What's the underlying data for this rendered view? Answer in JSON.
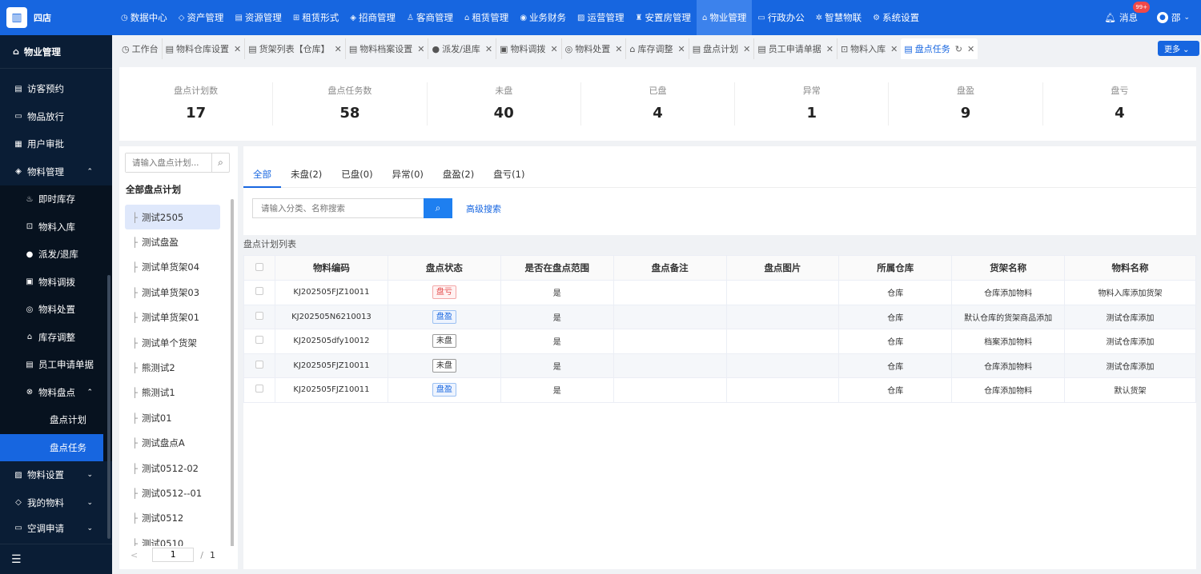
{
  "brand": {
    "logo": "四店",
    "name": "四店"
  },
  "topnav": {
    "items": [
      {
        "icon": "◷",
        "label": "数据中心"
      },
      {
        "icon": "◇",
        "label": "资产管理"
      },
      {
        "icon": "▤",
        "label": "资源管理"
      },
      {
        "icon": "⊞",
        "label": "租赁形式"
      },
      {
        "icon": "◈",
        "label": "招商管理"
      },
      {
        "icon": "♙",
        "label": "客商管理"
      },
      {
        "icon": "⌂",
        "label": "租赁管理"
      },
      {
        "icon": "◉",
        "label": "业务财务"
      },
      {
        "icon": "▨",
        "label": "运营管理"
      },
      {
        "icon": "♜",
        "label": "安置房管理"
      },
      {
        "icon": "⌂",
        "label": "物业管理"
      },
      {
        "icon": "▭",
        "label": "行政办公"
      },
      {
        "icon": "✲",
        "label": "智慧物联"
      },
      {
        "icon": "⚙",
        "label": "系统设置"
      }
    ],
    "active_index": 10,
    "messages_label": "消息",
    "messages_badge": "99+",
    "user_name": "邵"
  },
  "sidebar": {
    "header": "物业管理",
    "items": [
      {
        "icon": "▤",
        "label": "访客预约"
      },
      {
        "icon": "▭",
        "label": "物品放行"
      },
      {
        "icon": "▦",
        "label": "用户审批"
      },
      {
        "icon": "◈",
        "label": "物料管理",
        "chevron": "⌃"
      }
    ],
    "sub_items": [
      {
        "icon": "♨",
        "label": "即时库存"
      },
      {
        "icon": "⊡",
        "label": "物料入库"
      },
      {
        "icon": "●",
        "label": "派发/退库"
      },
      {
        "icon": "▣",
        "label": "物料调拨"
      },
      {
        "icon": "◎",
        "label": "物料处置"
      },
      {
        "icon": "⌂",
        "label": "库存调整"
      },
      {
        "icon": "▤",
        "label": "员工申请单据"
      },
      {
        "icon": "⊗",
        "label": "物料盘点",
        "chevron": "⌃"
      }
    ],
    "third_items": [
      {
        "label": "盘点计划"
      },
      {
        "label": "盘点任务"
      }
    ],
    "after_items": [
      {
        "icon": "▨",
        "label": "物料设置",
        "chevron": "⌄"
      },
      {
        "icon": "◇",
        "label": "我的物料",
        "chevron": "⌄"
      }
    ],
    "bottom_item": {
      "icon": "▭",
      "label": "空调申请",
      "chevron": "⌄"
    },
    "collapse_icon": "☰"
  },
  "tabs": [
    {
      "icon": "◷",
      "label": "工作台",
      "closable": false
    },
    {
      "icon": "▤",
      "label": "物料仓库设置",
      "closable": true
    },
    {
      "icon": "▤",
      "label": "货架列表【仓库】",
      "closable": true
    },
    {
      "icon": "▤",
      "label": "物料档案设置",
      "closable": true
    },
    {
      "icon": "●",
      "label": "派发/退库",
      "closable": true
    },
    {
      "icon": "▣",
      "label": "物料调拨",
      "closable": true
    },
    {
      "icon": "◎",
      "label": "物料处置",
      "closable": true
    },
    {
      "icon": "⌂",
      "label": "库存调整",
      "closable": true
    },
    {
      "icon": "▤",
      "label": "盘点计划",
      "closable": true
    },
    {
      "icon": "▤",
      "label": "员工申请单据",
      "closable": true
    },
    {
      "icon": "⊡",
      "label": "物料入库",
      "closable": true
    },
    {
      "icon": "▤",
      "label": "盘点任务",
      "closable": true,
      "active": true
    }
  ],
  "more_button": "更多 ⌄",
  "stats": [
    {
      "label": "盘点计划数",
      "value": "17"
    },
    {
      "label": "盘点任务数",
      "value": "58"
    },
    {
      "label": "未盘",
      "value": "40"
    },
    {
      "label": "已盘",
      "value": "4"
    },
    {
      "label": "异常",
      "value": "1"
    },
    {
      "label": "盘盈",
      "value": "9"
    },
    {
      "label": "盘亏",
      "value": "4"
    }
  ],
  "plan_panel": {
    "search_placeholder": "请输入盘点计划...",
    "title": "全部盘点计划",
    "plans": [
      "测试2505",
      "测试盘盈",
      "测试单货架04",
      "测试单货架03",
      "测试单货架01",
      "测试单个货架",
      "熊测试2",
      "熊测试1",
      "测试01",
      "测试盘点A",
      "测试0512-02",
      "测试0512--01",
      "测试0512",
      "测试0510"
    ],
    "active_index": 0,
    "pager": {
      "prev": "<",
      "current": "1",
      "separator": "/",
      "total": "1"
    }
  },
  "status_tabs": [
    {
      "label": "全部",
      "active": true
    },
    {
      "label": "未盘(2)"
    },
    {
      "label": "已盘(0)"
    },
    {
      "label": "异常(0)"
    },
    {
      "label": "盘盈(2)"
    },
    {
      "label": "盘亏(1)"
    }
  ],
  "search": {
    "placeholder": "请输入分类、名称搜索",
    "advanced": "高级搜索"
  },
  "list_title": "盘点计划列表",
  "table": {
    "columns": [
      "物料编码",
      "盘点状态",
      "是否在盘点范围",
      "盘点备注",
      "盘点图片",
      "所属仓库",
      "货架名称",
      "物料名称"
    ],
    "rows": [
      {
        "code": "KJ202505FJZ10011",
        "status": "盘亏",
        "status_type": "loss",
        "in_range": "是",
        "remark": "",
        "image": "",
        "warehouse": "仓库",
        "shelf": "仓库添加物料",
        "material": "物料入库添加货架"
      },
      {
        "code": "KJ202505N6210013",
        "status": "盘盈",
        "status_type": "gain",
        "in_range": "是",
        "remark": "",
        "image": "",
        "warehouse": "仓库",
        "shelf": "默认仓库的货架商品添加",
        "material": "测试仓库添加"
      },
      {
        "code": "KJ202505dfy10012",
        "status": "未盘",
        "status_type": "none",
        "in_range": "是",
        "remark": "",
        "image": "",
        "warehouse": "仓库",
        "shelf": "档案添加物料",
        "material": "测试仓库添加"
      },
      {
        "code": "KJ202505FJZ10011",
        "status": "未盘",
        "status_type": "none",
        "in_range": "是",
        "remark": "",
        "image": "",
        "warehouse": "仓库",
        "shelf": "仓库添加物料",
        "material": "测试仓库添加"
      },
      {
        "code": "KJ202505FJZ10011",
        "status": "盘盈",
        "status_type": "gain",
        "in_range": "是",
        "remark": "",
        "image": "",
        "warehouse": "仓库",
        "shelf": "仓库添加物料",
        "material": "默认货架"
      }
    ]
  }
}
